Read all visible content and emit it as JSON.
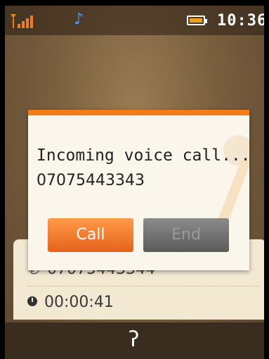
{
  "status_bar": {
    "signal_icon": "signal-bars-icon",
    "music_icon": "music-note-icon",
    "battery_icon": "battery-icon",
    "time": "10:36"
  },
  "background_card": {
    "number": "07075443344",
    "duration": "00:00:41"
  },
  "dialog": {
    "message": "Incoming voice call...",
    "number": "07075443343",
    "call_label": "Call",
    "end_label": "End"
  },
  "bottom_bar": {
    "icon": "hearing-icon"
  },
  "colors": {
    "accent": "#f07c1a",
    "call_button": "#f47b2c",
    "end_button": "#6e6e6e"
  }
}
